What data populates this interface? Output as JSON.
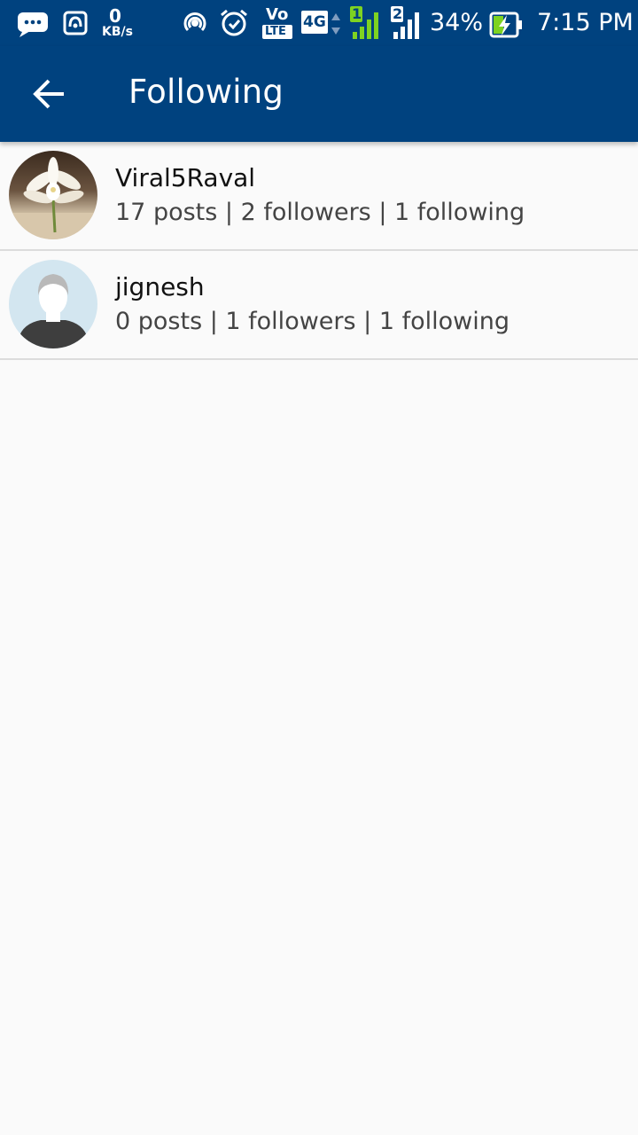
{
  "status_bar": {
    "net_speed_value": "0",
    "net_speed_unit": "KB/s",
    "volte_top": "Vo",
    "volte_bottom": "LTE",
    "network_type": "4G",
    "sim1_label": "1",
    "sim2_label": "2",
    "battery_percent": "34%",
    "time": "7:15 PM",
    "icons": [
      "message-icon",
      "hotspot-icon",
      "wifi-calling-icon",
      "alarm-icon",
      "volte-icon",
      "4g-icon",
      "sim1-signal-icon",
      "sim2-signal-icon",
      "battery-charging-icon"
    ],
    "sim1_color": "#7ed321"
  },
  "app_bar": {
    "title": "Following",
    "back_icon": "arrow-back-icon",
    "background": "#00427f"
  },
  "following": [
    {
      "username": "Viral5Raval",
      "stats": "17 posts | 2 followers | 1 following",
      "avatar": "flower-photo"
    },
    {
      "username": "jignesh",
      "stats": "0 posts | 1 followers | 1 following",
      "avatar": "default-person-avatar"
    }
  ]
}
